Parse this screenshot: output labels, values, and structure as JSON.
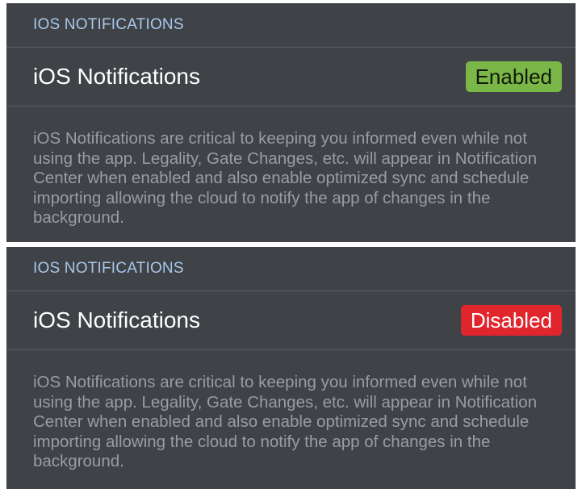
{
  "panels": [
    {
      "section_header": "IOS NOTIFICATIONS",
      "row_title": "iOS Notifications",
      "status": "Enabled",
      "status_color": "#7ab648",
      "description": "iOS Notifications are critical to keeping you informed even while not using the app. Legality, Gate Changes, etc. will appear in Notification Center when enabled and also enable optimized sync and schedule importing allowing the cloud to notify the app of changes in the background."
    },
    {
      "section_header": "IOS NOTIFICATIONS",
      "row_title": "iOS Notifications",
      "status": "Disabled",
      "status_color": "#e0252d",
      "description": "iOS Notifications are critical to keeping you informed even while not using the app. Legality, Gate Changes, etc. will appear in Notification Center when enabled and also enable optimized sync and schedule importing allowing the cloud to notify the app of changes in the background."
    }
  ]
}
